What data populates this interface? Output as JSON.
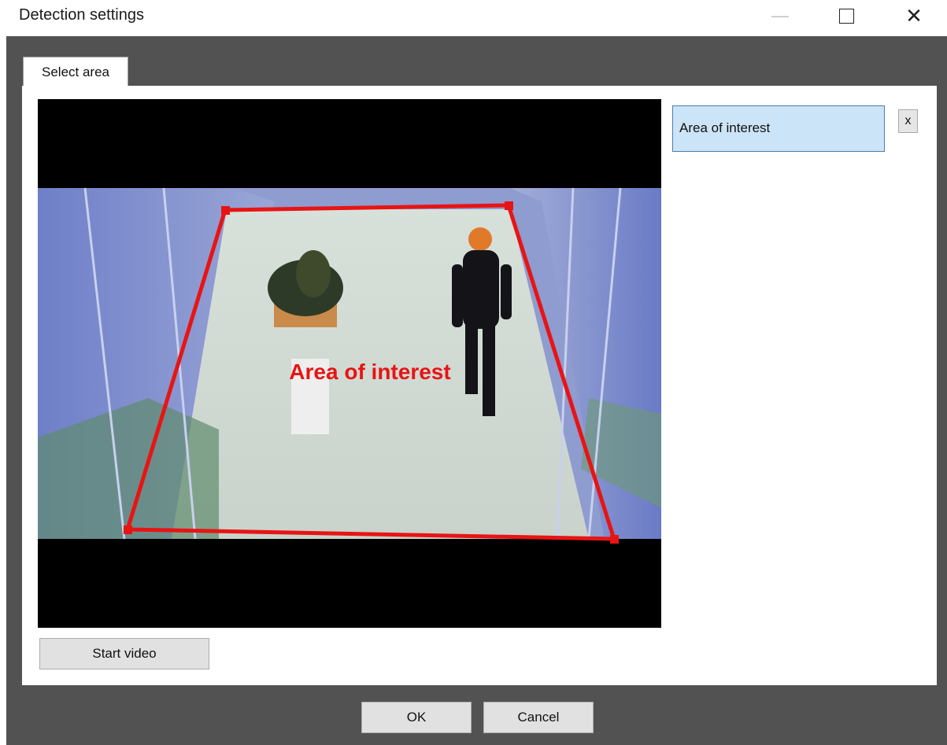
{
  "window": {
    "title": "Detection settings",
    "minimize_icon": "minimize-icon",
    "maximize_icon": "maximize-icon",
    "close_glyph": "✕"
  },
  "tabs": [
    {
      "label": "Select area"
    }
  ],
  "video": {
    "overlay_label": "Area of interest",
    "zone_color": "#e81414"
  },
  "areas": {
    "items": [
      {
        "label": "Area of interest",
        "selected": true
      }
    ],
    "remove_label": "x"
  },
  "buttons": {
    "start_video": "Start video",
    "ok": "OK",
    "cancel": "Cancel"
  },
  "colors": {
    "selection_bg": "#cce4f7",
    "selection_border": "#4a7fa8",
    "frame_bg": "#525252"
  }
}
